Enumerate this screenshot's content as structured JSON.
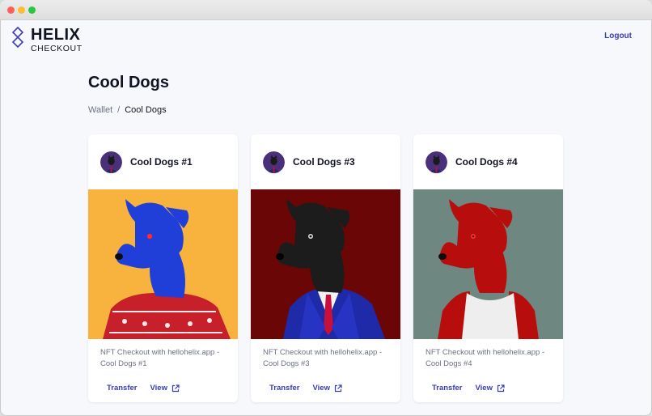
{
  "app": {
    "logo_title": "HELIX",
    "logo_subtitle": "CHECKOUT",
    "logout_label": "Logout"
  },
  "page": {
    "title": "Cool Dogs",
    "breadcrumb": {
      "parent": "Wallet",
      "separator": "/",
      "current": "Cool Dogs"
    }
  },
  "cards": [
    {
      "name": "Cool Dogs #1",
      "description": "NFT Checkout with hellohelix.app - Cool Dogs #1",
      "transfer_label": "Transfer",
      "view_label": "View",
      "background": "#f7b33e",
      "dog_color": "#1f3fd8",
      "outfit": "sweater"
    },
    {
      "name": "Cool Dogs #3",
      "description": "NFT Checkout with hellohelix.app - Cool Dogs #3",
      "transfer_label": "Transfer",
      "view_label": "View",
      "background": "#6a0606",
      "dog_color": "#1c1c1c",
      "outfit": "suit"
    },
    {
      "name": "Cool Dogs #4",
      "description": "NFT Checkout with hellohelix.app - Cool Dogs #4",
      "transfer_label": "Transfer",
      "view_label": "View",
      "background": "#6f8781",
      "dog_color": "#b80d0d",
      "outfit": "tank-top"
    }
  ],
  "colors": {
    "accent": "#3b3bb5",
    "page_bg": "#f7f8fb",
    "text": "#111322",
    "muted": "#6b7280"
  }
}
